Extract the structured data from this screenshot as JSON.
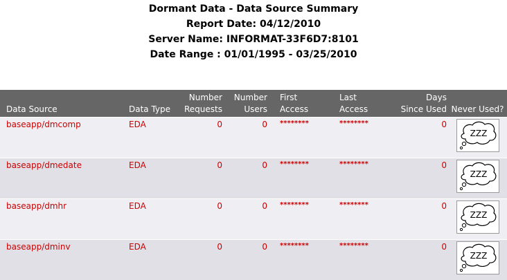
{
  "report": {
    "title": "Dormant Data - Data Source Summary",
    "report_date": "Report Date: 04/12/2010",
    "server_name": "Server Name: INFORMAT-33F6D7:8101",
    "date_range": "Date Range : 01/01/1995 - 03/25/2010"
  },
  "table": {
    "headers": {
      "data_source": "Data Source",
      "data_type": "Data Type",
      "number_requests_1": "Number",
      "number_requests_2": "Requests",
      "number_users_1": "Number",
      "number_users_2": "Users",
      "first_access_1": "First",
      "first_access_2": "Access",
      "last_access_1": "Last",
      "last_access_2": "Access",
      "days_since_used_1": "Days",
      "days_since_used_2": "Since Used",
      "never_used": "Never Used?"
    },
    "rows": [
      {
        "data_source": "baseapp/dmcomp",
        "data_type": "EDA",
        "number_requests": "0",
        "number_users": "0",
        "first_access": "********",
        "last_access": "********",
        "days_since_used": "0",
        "never_used_icon": "sleeping-zzz-icon",
        "never_used_text": "ZZZ"
      },
      {
        "data_source": "baseapp/dmedate",
        "data_type": "EDA",
        "number_requests": "0",
        "number_users": "0",
        "first_access": "********",
        "last_access": "********",
        "days_since_used": "0",
        "never_used_icon": "sleeping-zzz-icon",
        "never_used_text": "ZZZ"
      },
      {
        "data_source": "baseapp/dmhr",
        "data_type": "EDA",
        "number_requests": "0",
        "number_users": "0",
        "first_access": "********",
        "last_access": "********",
        "days_since_used": "0",
        "never_used_icon": "sleeping-zzz-icon",
        "never_used_text": "ZZZ"
      },
      {
        "data_source": "baseapp/dminv",
        "data_type": "EDA",
        "number_requests": "0",
        "number_users": "0",
        "first_access": "********",
        "last_access": "********",
        "days_since_used": "0",
        "never_used_icon": "sleeping-zzz-icon",
        "never_used_text": "ZZZ"
      }
    ]
  },
  "colors": {
    "header_bg": "#666666",
    "header_text": "#ffffff",
    "row_odd_bg": "#eeeef3",
    "row_even_bg": "#e0e0e6",
    "value_text": "#cc0000"
  }
}
